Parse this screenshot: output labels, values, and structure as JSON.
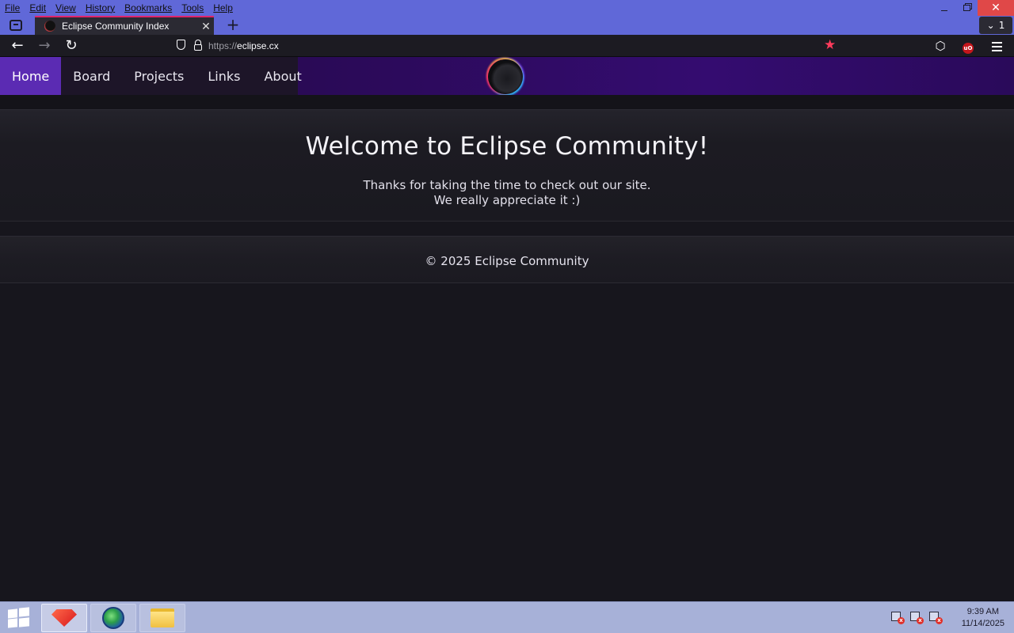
{
  "browser": {
    "menu": [
      "File",
      "Edit",
      "View",
      "History",
      "Bookmarks",
      "Tools",
      "Help"
    ],
    "window_controls": {
      "close": "✕"
    },
    "tab": {
      "title": "Eclipse Community Index",
      "close": "✕"
    },
    "new_tab": "+",
    "tabs_overflow": {
      "chevron": "⌄",
      "count": "1"
    },
    "url": {
      "protocol": "https://",
      "host": "eclipse.cx"
    },
    "colors": {
      "chrome": "#6068d8",
      "active_tab_border": "#e0246a",
      "bookmark_star": "#ff3b5c"
    }
  },
  "site": {
    "nav": [
      {
        "label": "Home",
        "active": true
      },
      {
        "label": "Board",
        "active": false
      },
      {
        "label": "Projects",
        "active": false
      },
      {
        "label": "Links",
        "active": false
      },
      {
        "label": "About",
        "active": false
      }
    ],
    "hero": {
      "title": "Welcome to Eclipse Community!",
      "line1": "Thanks for taking the time to check out our site.",
      "line2": "We really appreciate it :)"
    },
    "footer": {
      "copyright": "© 2025 Eclipse Community"
    },
    "colors": {
      "active_nav": "#5b2bb3",
      "header": "#340c70",
      "background": "#17161d"
    }
  },
  "taskbar": {
    "apps": [
      "gem-app",
      "browser-globe",
      "file-explorer"
    ],
    "clock": {
      "time": "9:39 AM",
      "date": "11/14/2025"
    }
  }
}
